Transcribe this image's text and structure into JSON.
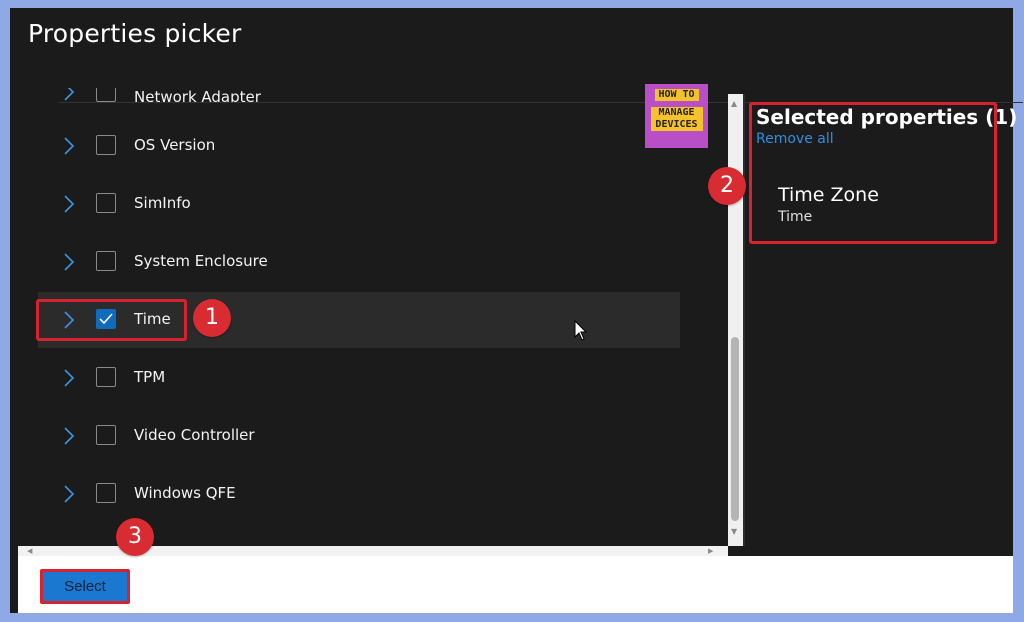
{
  "window": {
    "title": "Properties picker"
  },
  "logo": {
    "line1": "HOW TO",
    "line2": "MANAGE",
    "line3": "DEVICES"
  },
  "list": {
    "partial_item": "Network Adapter",
    "items": [
      {
        "label": "OS Version",
        "checked": false
      },
      {
        "label": "SimInfo",
        "checked": false
      },
      {
        "label": "System Enclosure",
        "checked": false
      },
      {
        "label": "Time",
        "checked": true
      },
      {
        "label": "TPM",
        "checked": false
      },
      {
        "label": "Video Controller",
        "checked": false
      },
      {
        "label": "Windows QFE",
        "checked": false
      }
    ]
  },
  "selected_panel": {
    "heading": "Selected properties (1)",
    "remove_all": "Remove all",
    "items": [
      {
        "name": "Time Zone",
        "category": "Time"
      }
    ]
  },
  "footer": {
    "select_label": "Select"
  },
  "annotations": {
    "m1": "1",
    "m2": "2",
    "m3": "3"
  },
  "colors": {
    "accent": "#0f6cbd",
    "highlight": "#d7232f",
    "link": "#2f8fe0"
  }
}
